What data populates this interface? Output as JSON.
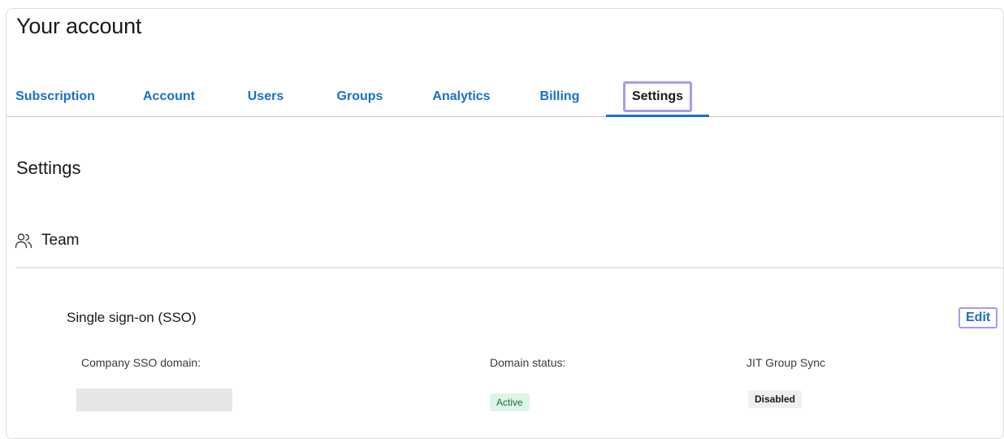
{
  "page": {
    "title": "Your account"
  },
  "tabs": [
    {
      "label": "Subscription"
    },
    {
      "label": "Account"
    },
    {
      "label": "Users"
    },
    {
      "label": "Groups"
    },
    {
      "label": "Analytics"
    },
    {
      "label": "Billing"
    },
    {
      "label": "Settings",
      "active": true
    }
  ],
  "settings": {
    "title": "Settings",
    "team": {
      "icon": "users-icon",
      "title": "Team",
      "sso": {
        "title": "Single sign-on (SSO)",
        "edit_label": "Edit",
        "fields": {
          "domain_label": "Company SSO domain:",
          "status_label": "Domain status:",
          "status_value": "Active",
          "jit_label": "JIT Group Sync",
          "jit_value": "Disabled"
        }
      }
    }
  },
  "colors": {
    "link": "#1a6fc9",
    "focus_outline": "#a79af0",
    "active_badge_bg": "#dcf5e6",
    "active_badge_text": "#1d6b3d",
    "disabled_badge_bg": "#efefef"
  }
}
